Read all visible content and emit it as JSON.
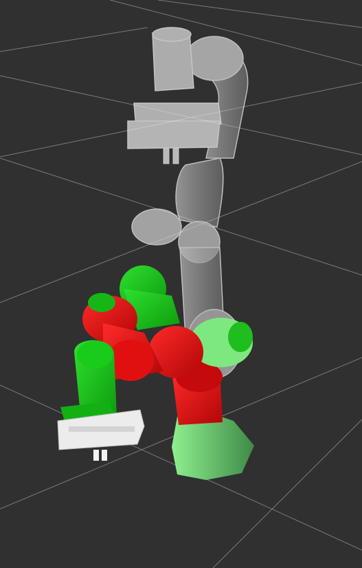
{
  "scene": {
    "background_color": "#303030",
    "grid_color": "#9a9a9a",
    "colors": {
      "ghost_body": "#d8d8d8",
      "ghost_edge": "#ffffff",
      "red_link": "#e60a0a",
      "red_shadow": "#9e0606",
      "green_link": "#14c814",
      "green_shadow": "#0d8f0d",
      "pale_green_base": "#6ee27a",
      "pale_green_shadow": "#3c9a48",
      "gripper_white": "#eeeeee",
      "gripper_shadow": "#b8b8b8"
    },
    "objects": [
      {
        "name": "robot-arm-ghost-goal",
        "kind": "translucent goal state"
      },
      {
        "name": "robot-arm-collision-state",
        "kind": "colored current state"
      }
    ]
  }
}
